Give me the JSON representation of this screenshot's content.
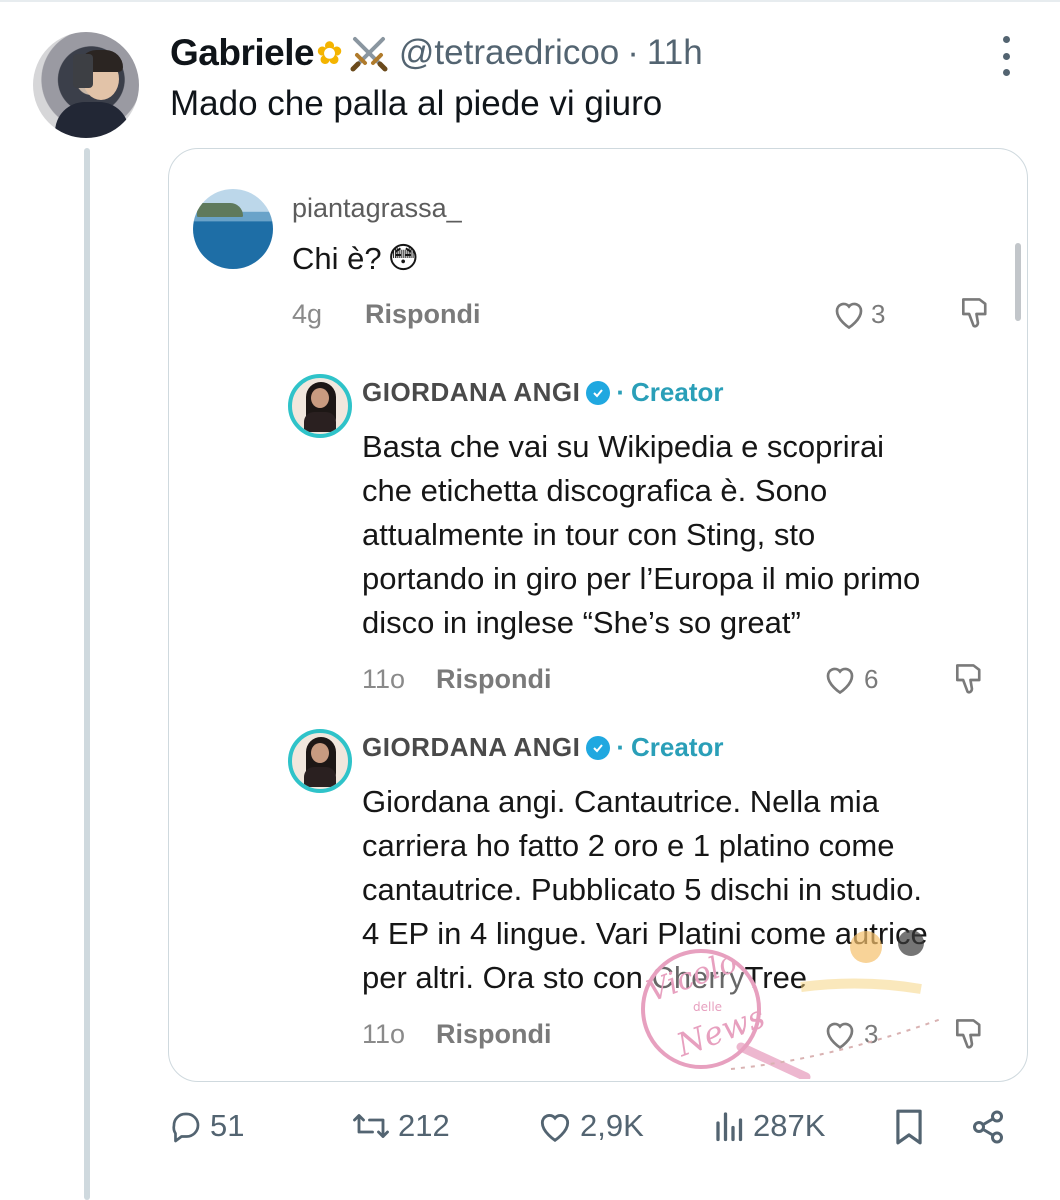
{
  "tweet": {
    "display_name": "Gabriele",
    "name_emojis": [
      "flower-emoji",
      "crossed-swords-emoji"
    ],
    "handle": "@tetraedricoo",
    "separator": "·",
    "time": "11h",
    "text": "Mado che palla al piede vi giuro"
  },
  "embedded_comments": [
    {
      "username": "piantagrassa_",
      "text": "Chi è?",
      "emoji": "😳",
      "age": "4g",
      "reply_label": "Rispondi",
      "likes": "3"
    },
    {
      "username": "GIORDANA ANGI",
      "verified": true,
      "separator": "·",
      "tag": "Creator",
      "lines": [
        "Basta che vai su Wikipedia e scoprirai",
        "che etichetta discografica è. Sono",
        "attualmente in tour con Sting, sto",
        "portando in giro per l’Europa il mio primo",
        "disco in inglese “She’s so great”"
      ],
      "age": "11o",
      "reply_label": "Rispondi",
      "likes": "6"
    },
    {
      "username": "GIORDANA ANGI",
      "verified": true,
      "separator": "·",
      "tag": "Creator",
      "lines": [
        "Giordana angi. Cantautrice. Nella mia",
        "carriera ho fatto 2 oro e 1 platino come",
        "cantautrice. Pubblicato 5 dischi in studio.",
        "4 EP in 4 lingue. Vari Platini come autrice",
        "per altri. Ora sto con CherryTree"
      ],
      "age": "11o",
      "reply_label": "Rispondi",
      "likes": "3"
    }
  ],
  "watermark": {
    "text_a": "Vicolo",
    "text_b": "delle",
    "text_c": "News"
  },
  "actions": {
    "replies": "51",
    "reposts": "212",
    "likes": "2,9K",
    "views": "287K"
  },
  "colors": {
    "accent_teal": "#2a9fb8",
    "verified_blue": "#20a8e0",
    "muted_text": "#536471",
    "watermark_pink": "#e7a0bf"
  }
}
